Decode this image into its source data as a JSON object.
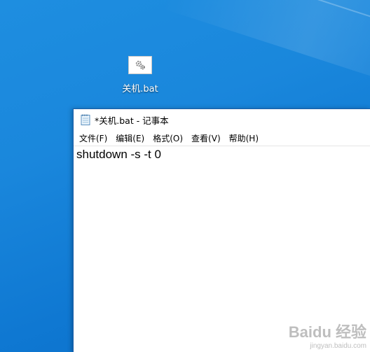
{
  "desktop": {
    "icons": [
      {
        "label": "关机.bat",
        "icon": "gears-icon"
      }
    ]
  },
  "notepad": {
    "title": "*关机.bat - 记事本",
    "icon": "notepad-icon",
    "menu": [
      {
        "label": "文件(F)"
      },
      {
        "label": "编辑(E)"
      },
      {
        "label": "格式(O)"
      },
      {
        "label": "查看(V)"
      },
      {
        "label": "帮助(H)"
      }
    ],
    "content": "shutdown -s -t 0"
  },
  "watermark": {
    "brand": "Baidu 经验",
    "url": "jingyan.baidu.com"
  },
  "colors": {
    "desktop_bg": "#1a87dc",
    "window_border": "#1b5ea8"
  }
}
